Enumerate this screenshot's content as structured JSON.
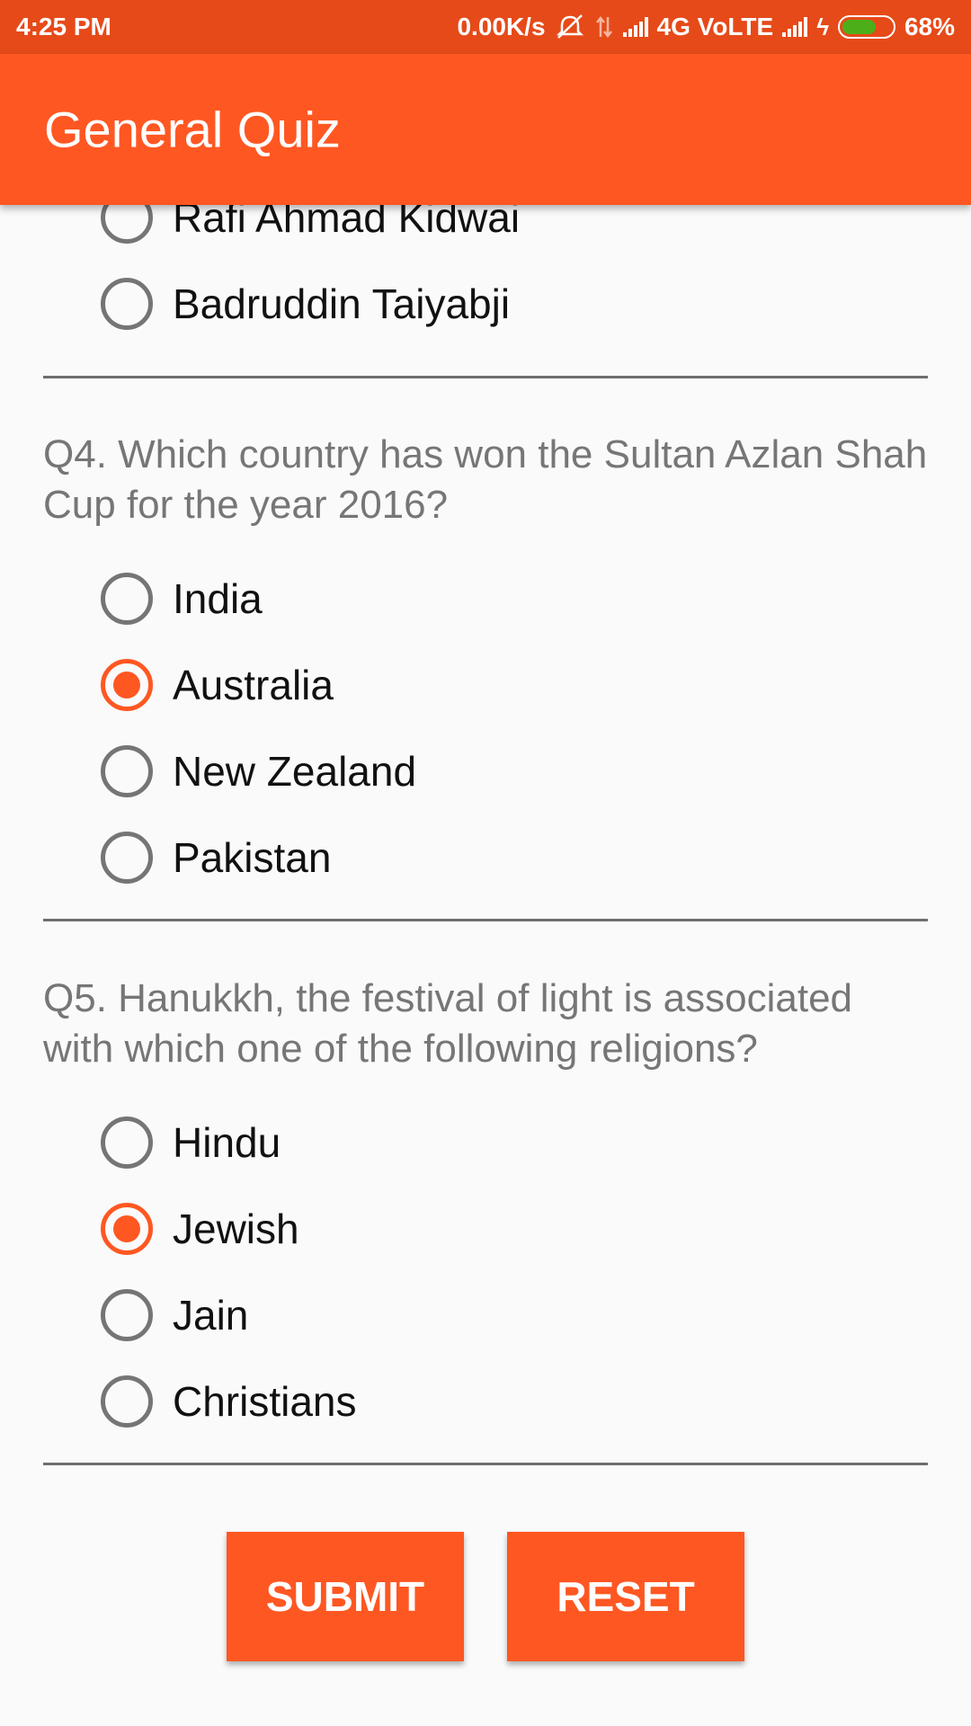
{
  "status_bar": {
    "time": "4:25 PM",
    "network_speed": "0.00K/s",
    "network_type": "4G VoLTE",
    "battery": "68%",
    "battery_level": 0.68,
    "icons": [
      "mute-icon",
      "data-arrows-icon",
      "signal-icon",
      "signal-icon",
      "charging-icon",
      "battery-icon"
    ]
  },
  "app_bar": {
    "title": "General Quiz"
  },
  "questions": [
    {
      "id": "q3",
      "text": "",
      "options": [
        {
          "label": "Rafi Ahmad Kidwai",
          "checked": false
        },
        {
          "label": "Badruddin Taiyabji",
          "checked": false
        }
      ]
    },
    {
      "id": "q4",
      "text": "Q4. Which country has won the Sultan Azlan Shah Cup for the year 2016?",
      "options": [
        {
          "label": "India",
          "checked": false
        },
        {
          "label": "Australia",
          "checked": true
        },
        {
          "label": "New Zealand",
          "checked": false
        },
        {
          "label": "Pakistan",
          "checked": false
        }
      ]
    },
    {
      "id": "q5",
      "text": "Q5. Hanukkh, the festival of light is associated with which one of the following religions?",
      "options": [
        {
          "label": "Hindu",
          "checked": false
        },
        {
          "label": "Jewish",
          "checked": true
        },
        {
          "label": "Jain",
          "checked": false
        },
        {
          "label": "Christians",
          "checked": false
        }
      ]
    }
  ],
  "buttons": {
    "submit_label": "SUBMIT",
    "reset_label": "RESET"
  },
  "colors": {
    "primary": "#FF5722",
    "primary_dark": "#E64A19",
    "radio_unchecked": "#757575",
    "question_text": "#767676",
    "battery_fill": "#4CAF1A"
  }
}
